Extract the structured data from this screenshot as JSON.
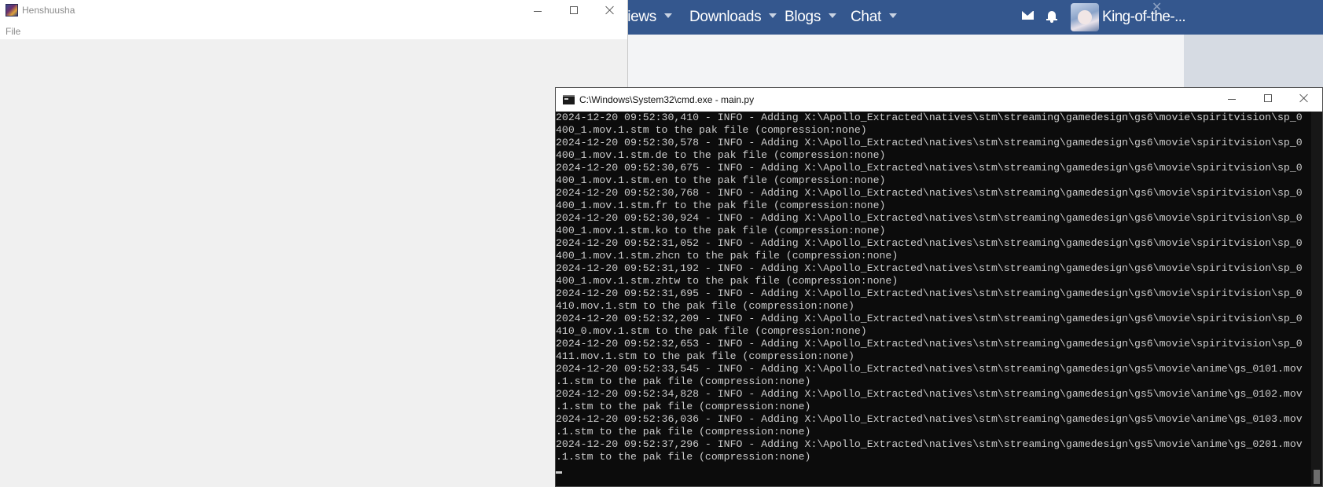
{
  "browser": {
    "nav_items": [
      {
        "label": "views"
      },
      {
        "label": "Downloads"
      },
      {
        "label": "Blogs"
      },
      {
        "label": "Chat"
      }
    ],
    "username": "King-of-the-..."
  },
  "henshuusha": {
    "title": "Henshuusha",
    "menu": {
      "file": "File"
    }
  },
  "cmd": {
    "title": "C:\\Windows\\System32\\cmd.exe - main.py",
    "lines": [
      "2024-12-20 09:52:30,410 - INFO - Adding X:\\Apollo_Extracted\\natives\\stm\\streaming\\gamedesign\\gs6\\movie\\spiritvision\\sp_0",
      "400_1.mov.1.stm to the pak file (compression:none)",
      "2024-12-20 09:52:30,578 - INFO - Adding X:\\Apollo_Extracted\\natives\\stm\\streaming\\gamedesign\\gs6\\movie\\spiritvision\\sp_0",
      "400_1.mov.1.stm.de to the pak file (compression:none)",
      "2024-12-20 09:52:30,675 - INFO - Adding X:\\Apollo_Extracted\\natives\\stm\\streaming\\gamedesign\\gs6\\movie\\spiritvision\\sp_0",
      "400_1.mov.1.stm.en to the pak file (compression:none)",
      "2024-12-20 09:52:30,768 - INFO - Adding X:\\Apollo_Extracted\\natives\\stm\\streaming\\gamedesign\\gs6\\movie\\spiritvision\\sp_0",
      "400_1.mov.1.stm.fr to the pak file (compression:none)",
      "2024-12-20 09:52:30,924 - INFO - Adding X:\\Apollo_Extracted\\natives\\stm\\streaming\\gamedesign\\gs6\\movie\\spiritvision\\sp_0",
      "400_1.mov.1.stm.ko to the pak file (compression:none)",
      "2024-12-20 09:52:31,052 - INFO - Adding X:\\Apollo_Extracted\\natives\\stm\\streaming\\gamedesign\\gs6\\movie\\spiritvision\\sp_0",
      "400_1.mov.1.stm.zhcn to the pak file (compression:none)",
      "2024-12-20 09:52:31,192 - INFO - Adding X:\\Apollo_Extracted\\natives\\stm\\streaming\\gamedesign\\gs6\\movie\\spiritvision\\sp_0",
      "400_1.mov.1.stm.zhtw to the pak file (compression:none)",
      "2024-12-20 09:52:31,695 - INFO - Adding X:\\Apollo_Extracted\\natives\\stm\\streaming\\gamedesign\\gs6\\movie\\spiritvision\\sp_0",
      "410.mov.1.stm to the pak file (compression:none)",
      "2024-12-20 09:52:32,209 - INFO - Adding X:\\Apollo_Extracted\\natives\\stm\\streaming\\gamedesign\\gs6\\movie\\spiritvision\\sp_0",
      "410_0.mov.1.stm to the pak file (compression:none)",
      "2024-12-20 09:52:32,653 - INFO - Adding X:\\Apollo_Extracted\\natives\\stm\\streaming\\gamedesign\\gs6\\movie\\spiritvision\\sp_0",
      "411.mov.1.stm to the pak file (compression:none)",
      "2024-12-20 09:52:33,545 - INFO - Adding X:\\Apollo_Extracted\\natives\\stm\\streaming\\gamedesign\\gs5\\movie\\anime\\gs_0101.mov",
      ".1.stm to the pak file (compression:none)",
      "2024-12-20 09:52:34,828 - INFO - Adding X:\\Apollo_Extracted\\natives\\stm\\streaming\\gamedesign\\gs5\\movie\\anime\\gs_0102.mov",
      ".1.stm to the pak file (compression:none)",
      "2024-12-20 09:52:36,036 - INFO - Adding X:\\Apollo_Extracted\\natives\\stm\\streaming\\gamedesign\\gs5\\movie\\anime\\gs_0103.mov",
      ".1.stm to the pak file (compression:none)",
      "2024-12-20 09:52:37,296 - INFO - Adding X:\\Apollo_Extracted\\natives\\stm\\streaming\\gamedesign\\gs5\\movie\\anime\\gs_0201.mov",
      ".1.stm to the pak file (compression:none)"
    ]
  },
  "colors": {
    "nav_bg": "#34578e",
    "console_bg": "#0c0c0c",
    "console_fg": "#cccccc"
  }
}
